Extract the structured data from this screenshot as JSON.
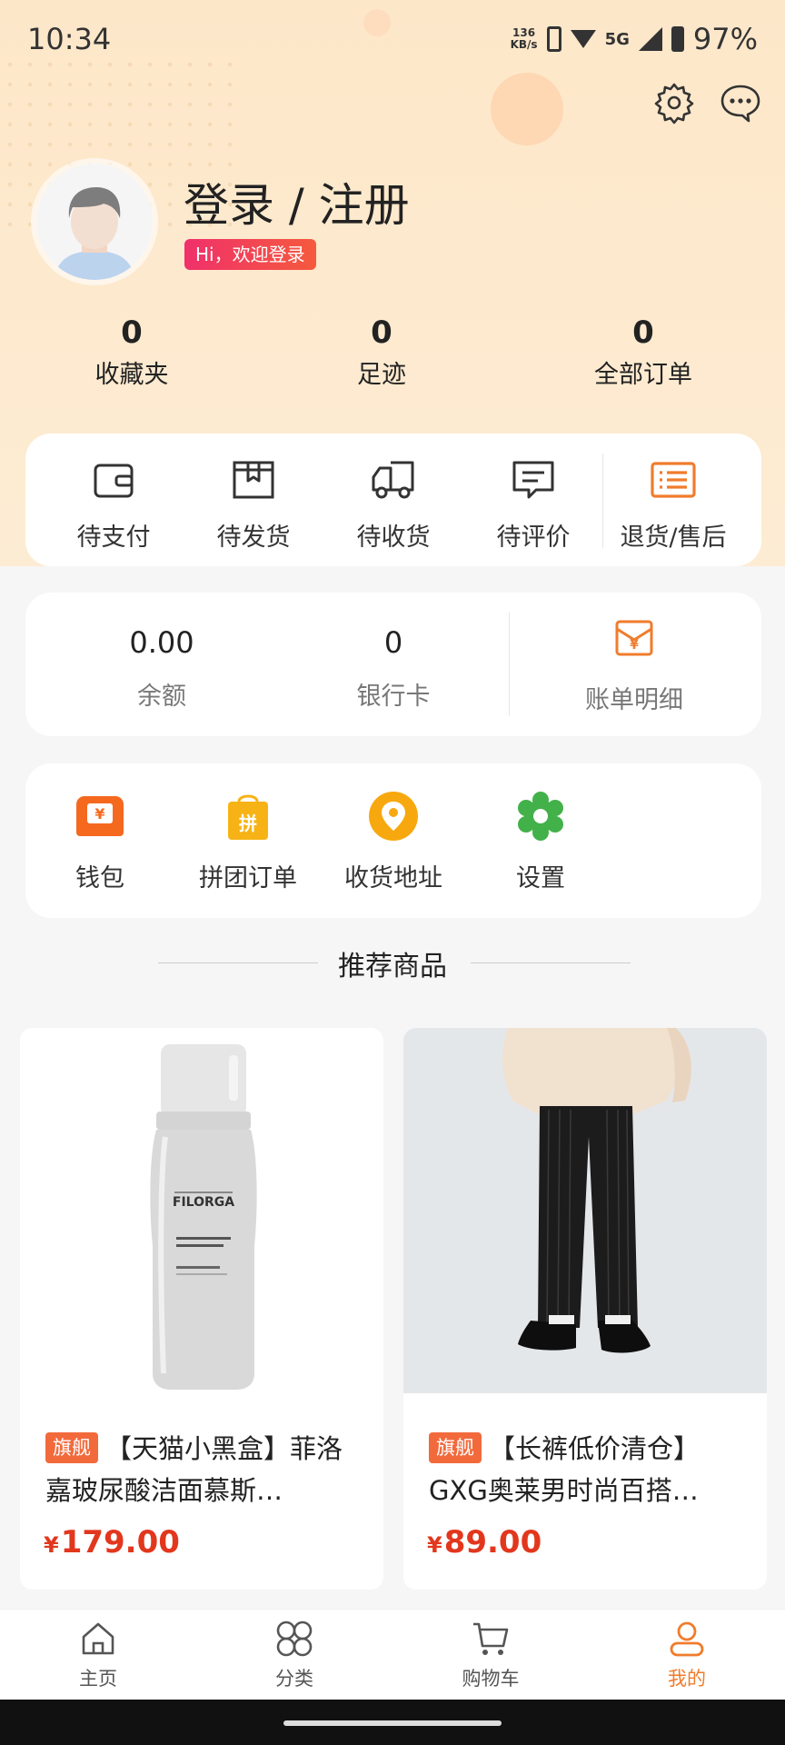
{
  "status_bar": {
    "time": "10:34",
    "speed_value": "136",
    "speed_unit": "KB/s",
    "network": "5G",
    "battery": "97%"
  },
  "profile": {
    "login_title": "登录 / 注册",
    "welcome": "Hi，欢迎登录"
  },
  "stats": [
    {
      "value": "0",
      "label": "收藏夹"
    },
    {
      "value": "0",
      "label": "足迹"
    },
    {
      "value": "0",
      "label": "全部订单"
    }
  ],
  "orders": [
    {
      "label": "待支付",
      "icon": "wallet-icon"
    },
    {
      "label": "待发货",
      "icon": "package-icon"
    },
    {
      "label": "待收货",
      "icon": "truck-icon"
    },
    {
      "label": "待评价",
      "icon": "comment-icon"
    },
    {
      "label": "退货/售后",
      "icon": "return-list-icon"
    }
  ],
  "wallet": {
    "balance_value": "0.00",
    "balance_label": "余额",
    "card_value": "0",
    "card_label": "银行卡",
    "bill_label": "账单明细"
  },
  "services": [
    {
      "label": "钱包",
      "icon": "wallet-card-icon",
      "color": "#f5691f"
    },
    {
      "label": "拼团订单",
      "icon": "group-bag-icon",
      "color": "#f7b316"
    },
    {
      "label": "收货地址",
      "icon": "location-pin-icon",
      "color": "#f7a80f"
    },
    {
      "label": "设置",
      "icon": "gear-icon",
      "color": "#43b14a"
    }
  ],
  "section_title": "推荐商品",
  "products": [
    {
      "tag": "旗舰",
      "title": "【天猫小黑盒】菲洛嘉玻尿酸洁面慕斯…",
      "currency": "¥",
      "price": "179.00",
      "bottle_brand": "FILORGA"
    },
    {
      "tag": "旗舰",
      "title": "【长裤低价清仓】GXG奥莱男时尚百搭…",
      "currency": "¥",
      "price": "89.00"
    }
  ],
  "tabs": [
    {
      "label": "主页",
      "icon": "home-icon"
    },
    {
      "label": "分类",
      "icon": "category-icon"
    },
    {
      "label": "购物车",
      "icon": "cart-icon"
    },
    {
      "label": "我的",
      "icon": "user-icon",
      "active": true
    }
  ],
  "colors": {
    "accent": "#f07c2c",
    "price": "#e2371d",
    "header_bg": "#fde7c9"
  }
}
